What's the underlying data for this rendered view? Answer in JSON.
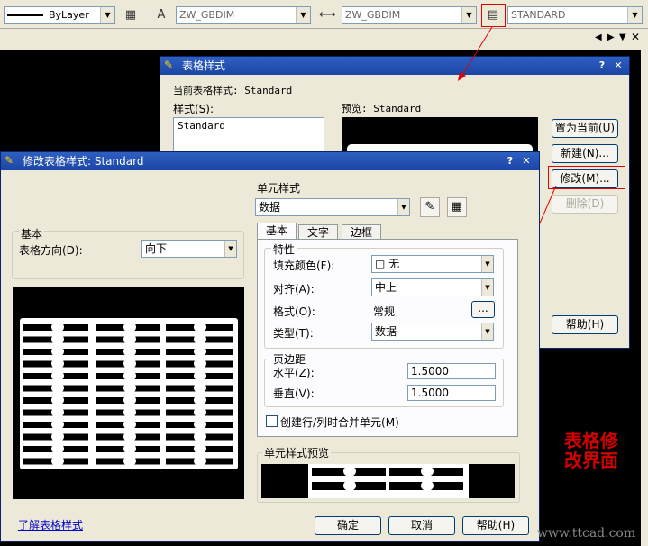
{
  "toolbar": {
    "linetype": "ByLayer",
    "text_style": "ZW_GBDIM",
    "dim_style": "ZW_GBDIM",
    "table_style": "STANDARD"
  },
  "table_dialog": {
    "title": "表格样式",
    "current_label": "当前表格样式: Standard",
    "styles_label": "样式(S):",
    "styles": [
      "Standard"
    ],
    "preview_label": "预览: Standard",
    "buttons": {
      "set_current": "置为当前(U)",
      "new": "新建(N)...",
      "modify": "修改(M)...",
      "delete": "删除(D)",
      "help": "帮助(H)"
    }
  },
  "modify_dialog": {
    "title": "修改表格样式: Standard",
    "basic_group": "基本",
    "direction_label": "表格方向(D):",
    "direction_value": "向下",
    "cell_style_label": "单元样式",
    "cell_style_value": "数据",
    "tabs": [
      "基本",
      "文字",
      "边框"
    ],
    "properties_group": "特性",
    "fill_color_label": "填充颜色(F):",
    "fill_color_value": "□ 无",
    "align_label": "对齐(A):",
    "align_value": "中上",
    "format_label": "格式(O):",
    "format_value": "常规",
    "format_btn": "...",
    "type_label": "类型(T):",
    "type_value": "数据",
    "margins_group": "页边距",
    "horizontal_label": "水平(Z):",
    "horizontal_value": "1.5000",
    "vertical_label": "垂直(V):",
    "vertical_value": "1.5000",
    "merge_label": "创建行/列时合并单元(M)",
    "cell_preview_label": "单元样式预览",
    "learn_link": "了解表格样式",
    "ok": "确定",
    "cancel": "取消",
    "help": "帮助(H)"
  },
  "annotation": {
    "line1": "表格修",
    "line2": "改界面",
    "color": "#d40000"
  },
  "watermark": "www.ttcad.com"
}
